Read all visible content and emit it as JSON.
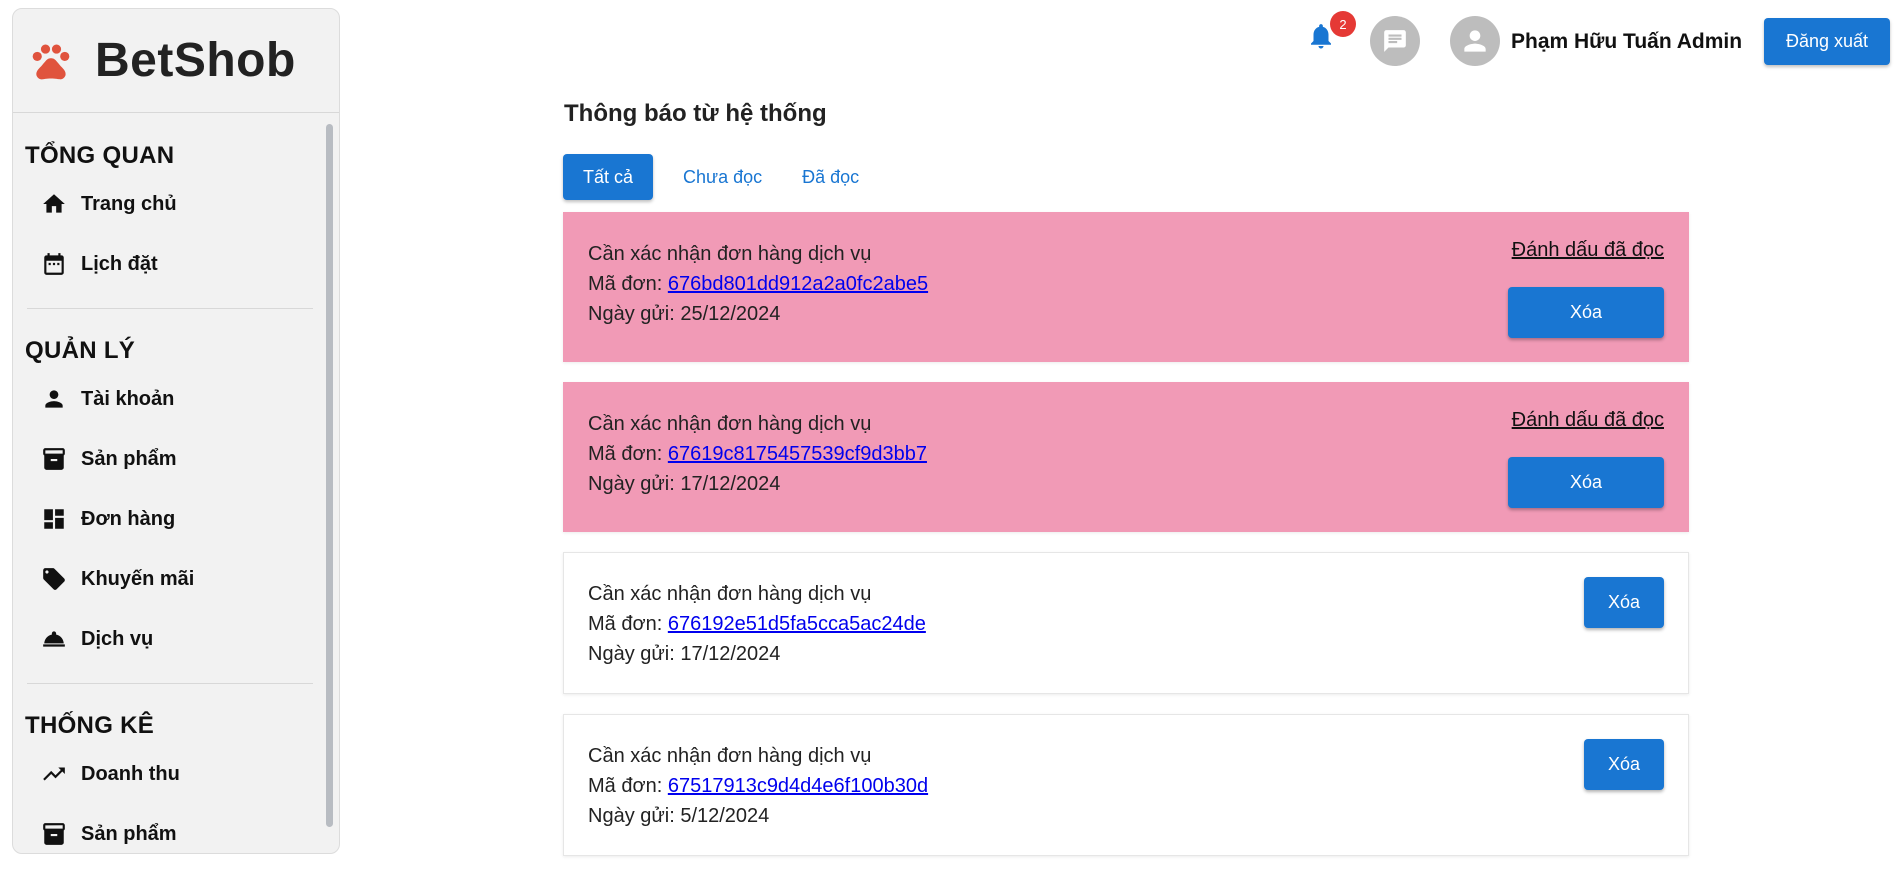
{
  "brand": {
    "name": "BetShob",
    "icon": "paw-icon",
    "icon_color": "#e0533d"
  },
  "sidebar": {
    "sections": [
      {
        "title": "TỔNG QUAN",
        "items": [
          {
            "label": "Trang chủ",
            "icon": "home-icon"
          },
          {
            "label": "Lịch đặt",
            "icon": "calendar-icon"
          }
        ]
      },
      {
        "title": "QUẢN LÝ",
        "items": [
          {
            "label": "Tài khoản",
            "icon": "person-icon"
          },
          {
            "label": "Sản phẩm",
            "icon": "archive-icon"
          },
          {
            "label": "Đơn hàng",
            "icon": "dashboard-icon"
          },
          {
            "label": "Khuyến mãi",
            "icon": "tag-icon"
          },
          {
            "label": "Dịch vụ",
            "icon": "room-service-icon"
          }
        ]
      },
      {
        "title": "THỐNG KÊ",
        "items": [
          {
            "label": "Doanh thu",
            "icon": "trending-up-icon"
          },
          {
            "label": "Sản phẩm",
            "icon": "archive-icon"
          }
        ]
      }
    ]
  },
  "header": {
    "notification_count": "2",
    "username": "Phạm Hữu Tuấn Admin",
    "logout_label": "Đăng xuất",
    "accent": "#1976d2"
  },
  "main": {
    "title": "Thông báo từ hệ thống",
    "tabs": [
      {
        "label": "Tất cả",
        "active": true
      },
      {
        "label": "Chưa đọc",
        "active": false
      },
      {
        "label": "Đã đọc",
        "active": false
      }
    ],
    "notifications": [
      {
        "title": "Cần xác nhận đơn hàng dịch vụ",
        "order_prefix": "Mã đơn: ",
        "order_id": "676bd801dd912a2a0fc2abe5",
        "date_prefix": "Ngày gửi: ",
        "date": "25/12/2024",
        "unread": true,
        "mark_label": "Đánh dấu đã đọc",
        "delete_label": "Xóa"
      },
      {
        "title": "Cần xác nhận đơn hàng dịch vụ",
        "order_prefix": "Mã đơn: ",
        "order_id": "67619c8175457539cf9d3bb7",
        "date_prefix": "Ngày gửi: ",
        "date": "17/12/2024",
        "unread": true,
        "mark_label": "Đánh dấu đã đọc",
        "delete_label": "Xóa"
      },
      {
        "title": "Cần xác nhận đơn hàng dịch vụ",
        "order_prefix": "Mã đơn: ",
        "order_id": "676192e51d5fa5cca5ac24de",
        "date_prefix": "Ngày gửi: ",
        "date": "17/12/2024",
        "unread": false,
        "delete_label": "Xóa"
      },
      {
        "title": "Cần xác nhận đơn hàng dịch vụ",
        "order_prefix": "Mã đơn: ",
        "order_id": "67517913c9d4d4e6f100b30d",
        "date_prefix": "Ngày gửi: ",
        "date": "5/12/2024",
        "unread": false,
        "delete_label": "Xóa"
      }
    ],
    "unread_color": "#f19ab6"
  }
}
